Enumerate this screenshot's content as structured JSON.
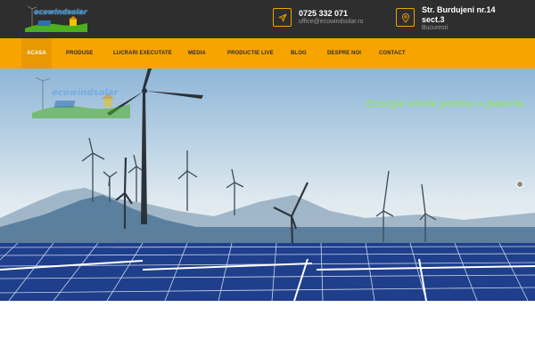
{
  "header": {
    "logo_text": "ecowindsolar",
    "phone": "0725 332 071",
    "email": "office@ecowindsolar.ro",
    "address_line1": "Str. Burdujeni nr.14",
    "address_line2": "sect.3",
    "city": "Bucuresti"
  },
  "nav": {
    "items": [
      {
        "label": "ACASA",
        "active": true
      },
      {
        "label": "PRODUSE"
      },
      {
        "label": "LUCRARI EXECUTATE"
      },
      {
        "label": "MEDIA"
      },
      {
        "label": "PRODUCTIE LIVE"
      },
      {
        "label": "BLOG"
      },
      {
        "label": "DESPRE NOI"
      },
      {
        "label": "CONTACT"
      }
    ]
  },
  "hero": {
    "headline": "Energie verde pentru o planeta",
    "watermark_logo_text": "ecowindsolar"
  },
  "icons": {
    "phone": "send-icon",
    "address": "map-pin-icon"
  },
  "colors": {
    "topbar": "#2e2e2e",
    "accent": "#f7a400",
    "headline": "#8fe16f"
  }
}
